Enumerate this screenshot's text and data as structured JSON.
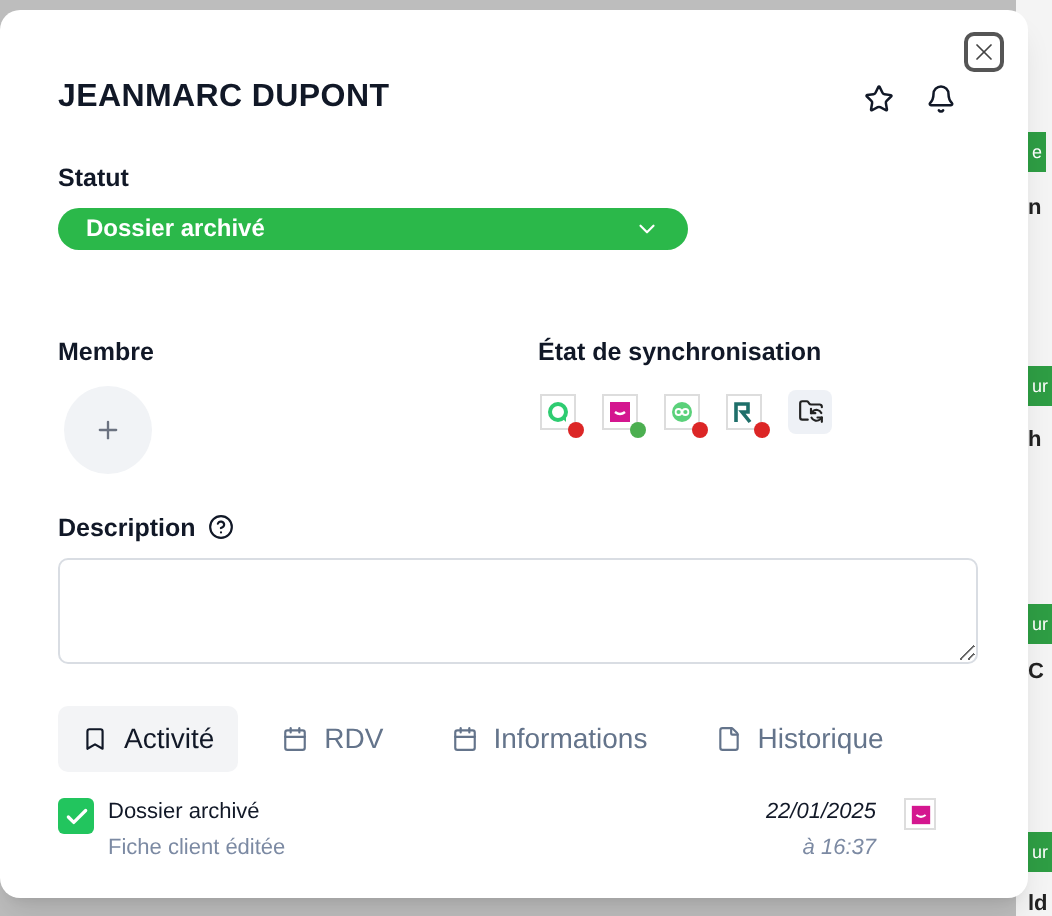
{
  "background_fragments": [
    {
      "kind": "badge",
      "text": "e"
    },
    {
      "kind": "text",
      "text": "n"
    },
    {
      "kind": "badge",
      "text": "ur"
    },
    {
      "kind": "text",
      "text": "h"
    },
    {
      "kind": "badge",
      "text": "ur"
    },
    {
      "kind": "text",
      "text": "C"
    },
    {
      "kind": "badge",
      "text": "ur"
    },
    {
      "kind": "text",
      "text": "ld"
    }
  ],
  "modal": {
    "title": "JEANMARC DUPONT",
    "favorite": false,
    "status": {
      "label": "Statut",
      "value": "Dossier archivé"
    },
    "member": {
      "label": "Membre"
    },
    "sync": {
      "label": "État de synchronisation",
      "apps": [
        {
          "kind": "chat",
          "color": "#dc2626"
        },
        {
          "kind": "pink",
          "color": "#4caf50"
        },
        {
          "kind": "loop",
          "color": "#dc2626"
        },
        {
          "kind": "r",
          "color": "#dc2626"
        }
      ]
    },
    "description": {
      "label": "Description"
    },
    "tabs": [
      {
        "label": "Activité",
        "selected": true
      },
      {
        "label": "RDV",
        "selected": false
      },
      {
        "label": "Informations",
        "selected": false
      },
      {
        "label": "Historique",
        "selected": false
      }
    ],
    "activity": [
      {
        "title": "Dossier archivé",
        "subtitle": "Fiche client éditée",
        "date": "22/01/2025",
        "time": "à 16:37",
        "checked": true,
        "kind": "pink"
      }
    ]
  }
}
